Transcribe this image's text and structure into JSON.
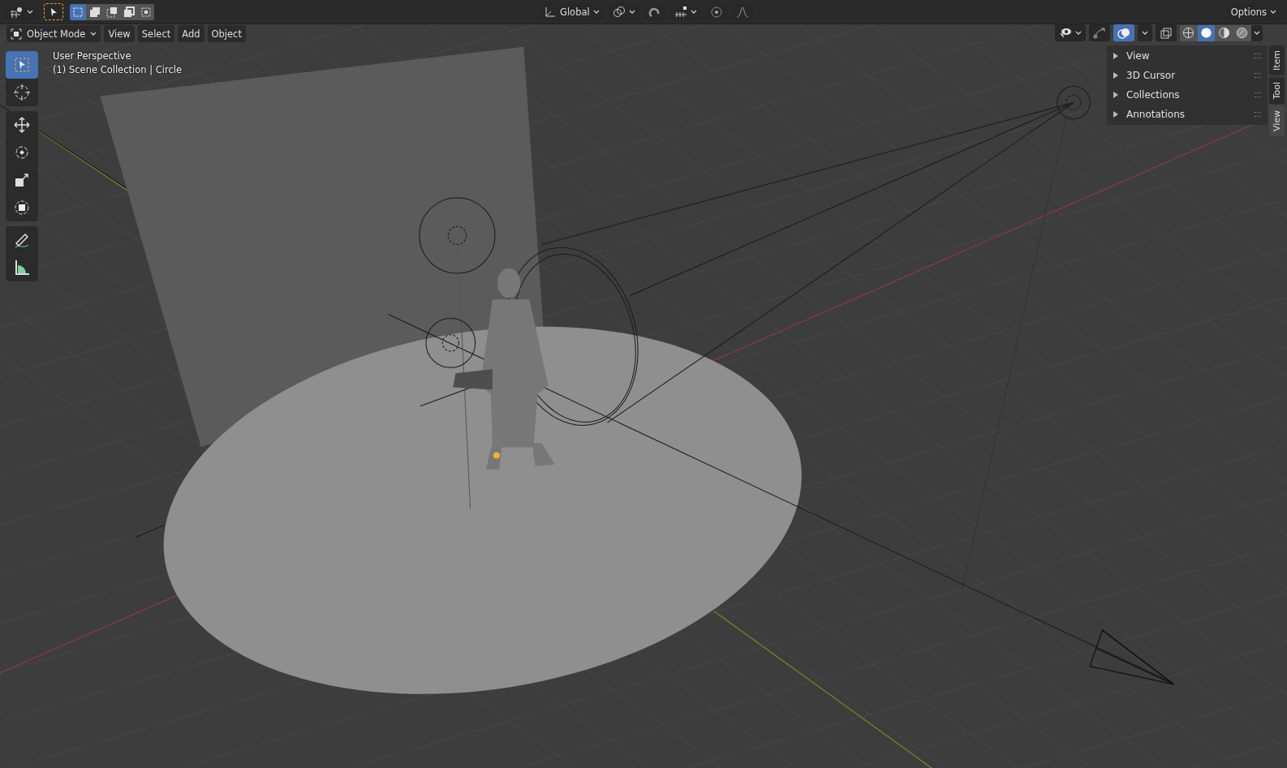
{
  "header": {
    "editor_type": {
      "kind": "viewport"
    },
    "active_tool": {
      "selected": true
    },
    "select_modes": [
      {
        "kind": "new",
        "selected": true
      },
      {
        "kind": "extend",
        "selected": false
      },
      {
        "kind": "subtract",
        "selected": false
      },
      {
        "kind": "invert",
        "selected": false
      },
      {
        "kind": "intersect",
        "selected": false
      }
    ],
    "orientation": "Global",
    "snap": {
      "on": false
    },
    "proportional_editing": {
      "on": false
    },
    "options": "Options"
  },
  "menu_bar": {
    "mode": "Object Mode",
    "menus": [
      "View",
      "Select",
      "Add",
      "Object"
    ]
  },
  "viewport_info": [
    "User Perspective",
    "(1) Scene Collection | Circle"
  ],
  "toolbar": {
    "tools": [
      {
        "kind": "select",
        "selected": true
      },
      {
        "kind": "cursor",
        "selected": false
      },
      {
        "kind": "move",
        "selected": false
      },
      {
        "kind": "rotate",
        "selected": false
      },
      {
        "kind": "scale",
        "selected": false
      },
      {
        "kind": "transform",
        "selected": false
      },
      {
        "kind": "annotate",
        "selected": false
      },
      {
        "kind": "measure",
        "selected": false
      }
    ]
  },
  "view_controls": {
    "gizmos": {
      "on": false
    },
    "overlays": {
      "on": true
    },
    "xray": {
      "on": false
    },
    "shading_modes": [
      {
        "kind": "wireframe",
        "selected": false
      },
      {
        "kind": "solid",
        "selected": true
      },
      {
        "kind": "material",
        "selected": false
      },
      {
        "kind": "rendered",
        "selected": false
      }
    ]
  },
  "sidebar": {
    "panels": [
      {
        "label": "View",
        "expanded": false
      },
      {
        "label": "3D Cursor",
        "expanded": false
      },
      {
        "label": "Collections",
        "expanded": false
      },
      {
        "label": "Annotations",
        "expanded": false
      }
    ],
    "tabs": [
      {
        "label": "Item",
        "selected": false
      },
      {
        "label": "Tool",
        "selected": false
      },
      {
        "label": "View",
        "selected": true
      }
    ]
  }
}
